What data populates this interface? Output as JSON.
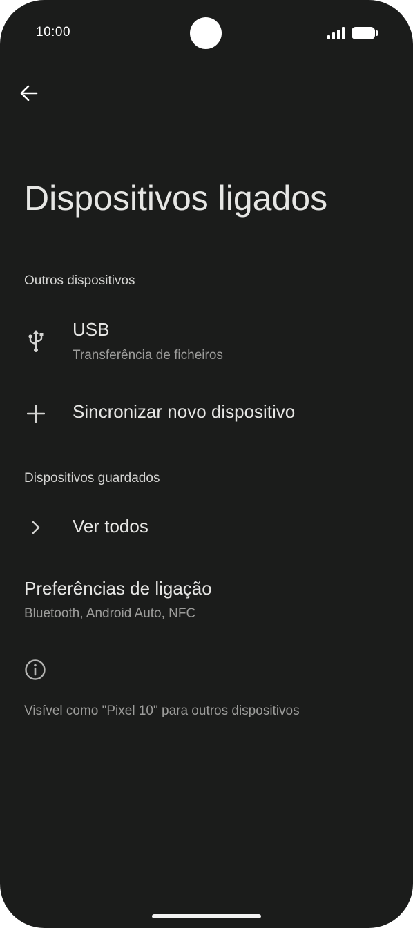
{
  "status_bar": {
    "time": "10:00",
    "icons": [
      "signal-icon",
      "battery-icon"
    ]
  },
  "header": {
    "back_icon": "arrow-back-icon",
    "title": "Dispositivos ligados"
  },
  "sections": {
    "other_devices": {
      "header": "Outros dispositivos",
      "usb": {
        "icon": "usb-icon",
        "title": "USB",
        "subtitle": "Transferência de ficheiros"
      },
      "pair_new": {
        "icon": "plus-icon",
        "title": "Sincronizar novo dispositivo"
      }
    },
    "saved_devices": {
      "header": "Dispositivos guardados",
      "see_all": {
        "icon": "chevron-right-icon",
        "title": "Ver todos"
      }
    }
  },
  "connection_preferences": {
    "title": "Preferências de ligação",
    "subtitle": "Bluetooth, Android Auto, NFC"
  },
  "footer": {
    "icon": "info-icon",
    "text": "Visível como \"Pixel 10\" para outros dispositivos"
  },
  "colors": {
    "background": "#1b1c1b",
    "primary_text": "#e6e6e4",
    "secondary_text": "#9d9d9b",
    "divider": "#3e3f3e"
  }
}
